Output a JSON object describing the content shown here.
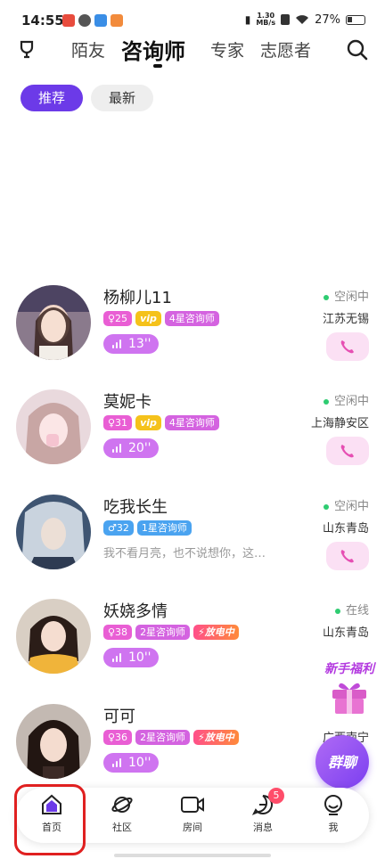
{
  "statusbar": {
    "time": "14:55",
    "netspeed_top": "1.30",
    "netspeed_bottom": "MB/s",
    "battery": "27%"
  },
  "topnav": {
    "tabs": [
      {
        "label": "陌友"
      },
      {
        "label": "咨询师"
      },
      {
        "label": "专家"
      },
      {
        "label": "志愿者"
      }
    ]
  },
  "filters": {
    "recommend": "推荐",
    "latest": "最新"
  },
  "cards": [
    {
      "name": "杨柳儿11",
      "gender_age": "♀25",
      "vip": "vip",
      "level": "4星咨询师",
      "voice": "13''",
      "status": "空闲中",
      "location": "江苏无锡"
    },
    {
      "name": "莫妮卡",
      "gender_age": "♀31",
      "vip": "vip",
      "level": "4星咨询师",
      "voice": "20''",
      "status": "空闲中",
      "location": "上海静安区"
    },
    {
      "name": "吃我长生",
      "gender_age": "♂32",
      "level": "1星咨询师",
      "signature": "我不看月亮，也不说想你，这…",
      "status": "空闲中",
      "location": "山东青岛"
    },
    {
      "name": "妖娆多情",
      "gender_age": "♀38",
      "level": "2星咨询师",
      "electric": "放电中",
      "voice": "10''",
      "status": "在线",
      "location": "山东青岛"
    },
    {
      "name": "可可",
      "gender_age": "♀36",
      "level": "2星咨询师",
      "electric": "放电中",
      "voice": "10''",
      "location": "广西南宁"
    }
  ],
  "floating": {
    "newbie": "新手福利",
    "group": "群聊"
  },
  "bottombar": {
    "items": [
      {
        "label": "首页"
      },
      {
        "label": "社区"
      },
      {
        "label": "房间"
      },
      {
        "label": "消息",
        "badge": "5"
      },
      {
        "label": "我"
      }
    ]
  },
  "colors": {
    "accent": "#6c3ae8",
    "pink": "#e95ed4",
    "highlight": "#e02020"
  }
}
